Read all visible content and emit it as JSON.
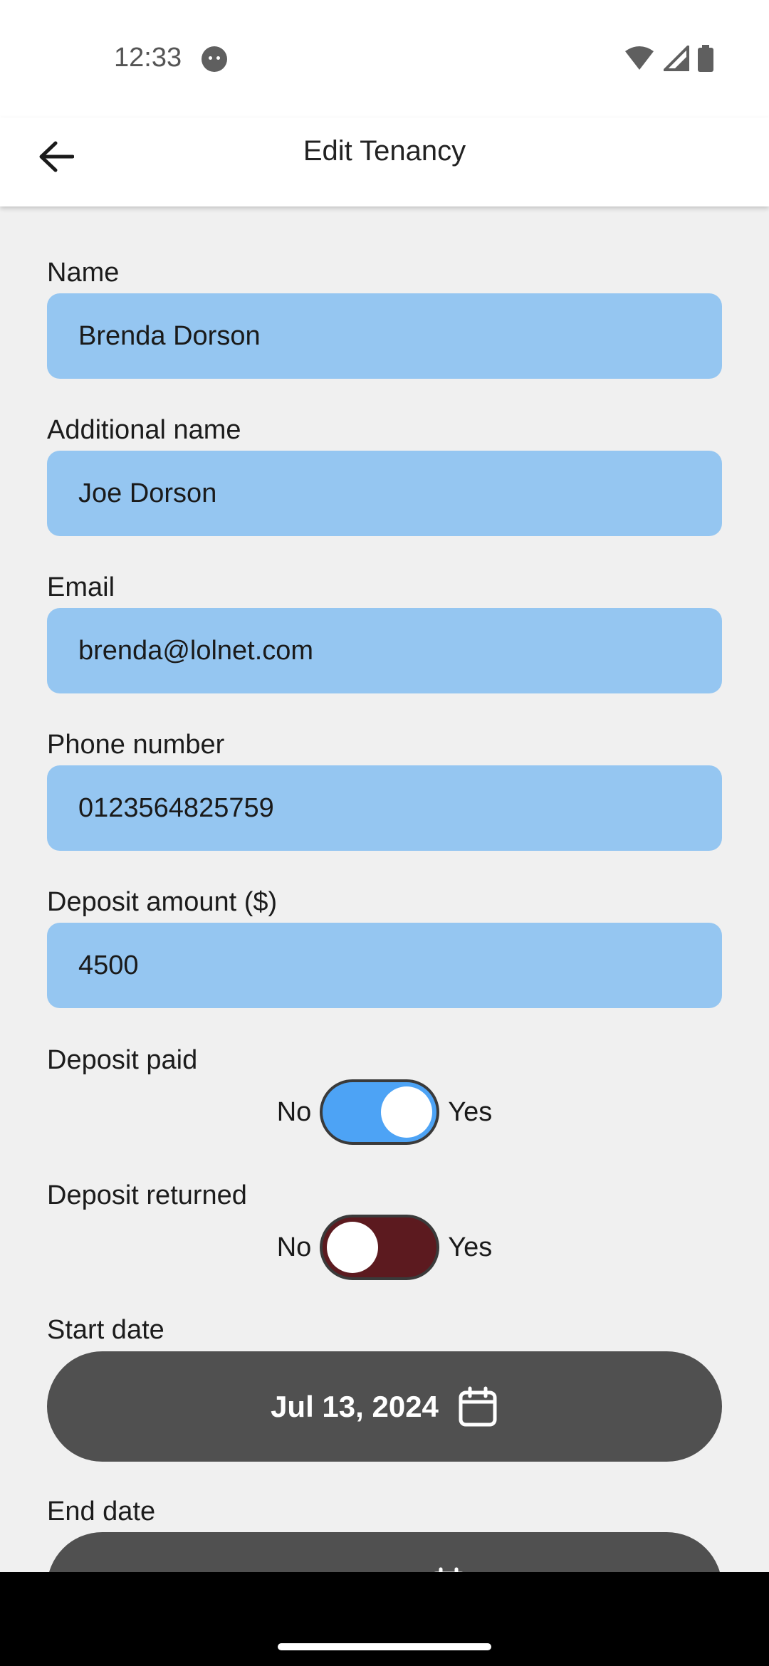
{
  "status_bar": {
    "time": "12:33",
    "icons": [
      "face-icon",
      "wifi-icon",
      "signal-icon",
      "battery-icon"
    ]
  },
  "app_bar": {
    "title": "Edit Tenancy",
    "back_icon": "arrow-back-icon"
  },
  "form": {
    "name": {
      "label": "Name",
      "value": "Brenda Dorson"
    },
    "additional_name": {
      "label": "Additional name",
      "value": "Joe Dorson"
    },
    "email": {
      "label": "Email",
      "value": "brenda@lolnet.com"
    },
    "phone": {
      "label": "Phone number",
      "value": "0123564825759"
    },
    "deposit_amount": {
      "label": "Deposit amount ($)",
      "value": "4500"
    },
    "deposit_paid": {
      "label": "Deposit paid",
      "off_text": "No",
      "on_text": "Yes",
      "state": true,
      "color": "#4da3f5"
    },
    "deposit_returned": {
      "label": "Deposit returned",
      "off_text": "No",
      "on_text": "Yes",
      "state": false,
      "color": "#5c1a1f"
    },
    "start_date": {
      "label": "Start date",
      "value": "Jul 13, 2024",
      "icon": "calendar-icon"
    },
    "end_date": {
      "label": "End date",
      "icon": "calendar-icon"
    }
  },
  "colors": {
    "input_bg": "#95c6f1",
    "date_button_bg": "#505050",
    "background": "#f0f0f0"
  }
}
